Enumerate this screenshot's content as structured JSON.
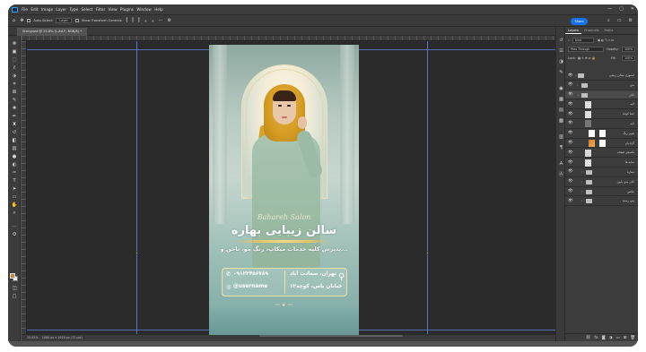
{
  "menubar": {
    "items": [
      "File",
      "Edit",
      "Image",
      "Layer",
      "Type",
      "Select",
      "Filter",
      "View",
      "Plugins",
      "Window",
      "Help"
    ]
  },
  "window_controls": [
    "—",
    "▢",
    "✕"
  ],
  "options_bar": {
    "auto_select_label": "Auto-Select:",
    "auto_select_value": "Layer",
    "transform_label": "Show Transform Controls",
    "share_label": "Share"
  },
  "document": {
    "tab_title": "Storypost @ 25.8% (L-Ad-F, RGB/8) *"
  },
  "status_bar": {
    "zoom": "25.81%",
    "doc_info": "1080 px x 1920 px (72 ppi)"
  },
  "artboard": {
    "script_text": "Bahareh Salon",
    "title": "سالن زیبایی بهاره",
    "subtitle": "پذیرش کلیه خدمات میکاپ، رنگ مو، ناخن و...",
    "phone": "۰۹۱۲۳۴۵۶۷۸۹",
    "username": "@username",
    "address_line1": "تهران، سعادت آباد",
    "address_line2": "خیابان یاس، کوچه۱۲",
    "ornament": "〰 ❦ 〰"
  },
  "layers_panel": {
    "tabs": [
      "Layers",
      "Channels",
      "Paths"
    ],
    "filter_label": "Kind",
    "blend_mode": "Pass Through",
    "opacity_label": "Opacity:",
    "opacity_value": "100%",
    "lock_label": "Lock:",
    "fill_label": "Fill:",
    "fill_value": "100%",
    "layers": [
      {
        "name": "استوری سالن زیبایی",
        "type": "folder"
      },
      {
        "name": "متن",
        "type": "folder"
      },
      {
        "name": "کادر",
        "type": "folder"
      },
      {
        "name": "لایه",
        "type": "pixel"
      },
      {
        "name": "خط کوتاه",
        "type": "pixel"
      },
      {
        "name": "لایه",
        "type": "pixel"
      },
      {
        "name": "تغییر رنگ",
        "type": "adjustment"
      },
      {
        "name": "گرادیان",
        "type": "adjustment"
      },
      {
        "name": "تکسچر صفحه",
        "type": "pixel"
      },
      {
        "name": "سایه ها",
        "type": "pixel"
      },
      {
        "name": "ستاره",
        "type": "folder"
      },
      {
        "name": "کادر متن پایین",
        "type": "folder"
      },
      {
        "name": "عکس",
        "type": "folder"
      },
      {
        "name": "پس زمینه",
        "type": "folder"
      }
    ]
  },
  "colors": {
    "accent": "#1473e6",
    "foreground_swatch": "#b88a3a",
    "background_swatch": "#ececec",
    "guide": "#5c7fd8"
  }
}
